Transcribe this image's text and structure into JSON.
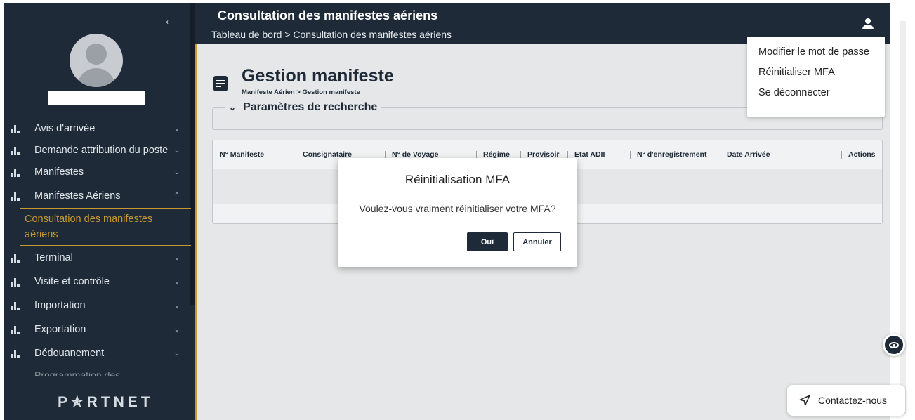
{
  "header": {
    "title": "Consultation des manifestes aériens",
    "breadcrumb": "Tableau de bord > Consultation des manifestes aériens"
  },
  "sidebar": {
    "items": [
      {
        "label": "Avis d'arrivée",
        "chevron": "down"
      },
      {
        "label": "Demande attribution du poste",
        "chevron": "down"
      },
      {
        "label": "Manifestes",
        "chevron": "down"
      },
      {
        "label": "Manifestes Aériens",
        "chevron": "up"
      },
      {
        "label": "Terminal",
        "chevron": "down"
      },
      {
        "label": "Visite et contrôle",
        "chevron": "down"
      },
      {
        "label": "Importation",
        "chevron": "down"
      },
      {
        "label": "Exportation",
        "chevron": "down"
      },
      {
        "label": "Dédouanement",
        "chevron": "down"
      }
    ],
    "active_sub": "Consultation des manifestes aériens",
    "faded_item": "Programmation des",
    "logo": "P✯RTNET"
  },
  "page": {
    "title": "Gestion manifeste",
    "subtitle": "Manifeste Aérien > Gestion manifeste",
    "search_label": "Paramètres de recherche"
  },
  "table": {
    "columns": [
      "N° Manifeste",
      "Consignataire",
      "N° de Voyage",
      "Régime",
      "Provisoir",
      "Etat ADII",
      "N° d'enregistrement",
      "Date Arrivée",
      "",
      "Actions"
    ]
  },
  "user_menu": {
    "items": [
      "Modifier le mot de passe",
      "Réinitialiser MFA",
      "Se déconnecter"
    ]
  },
  "modal": {
    "title": "Réinitialisation MFA",
    "message": "Voulez-vous vraiment réinitialiser votre MFA?",
    "confirm": "Oui",
    "cancel": "Annuler"
  },
  "floating": {
    "contact": "Contactez-nous"
  },
  "colors": {
    "sidebar_bg": "#1e2a38",
    "accent": "#c79a2e",
    "content_bg": "#e6e7e8"
  }
}
